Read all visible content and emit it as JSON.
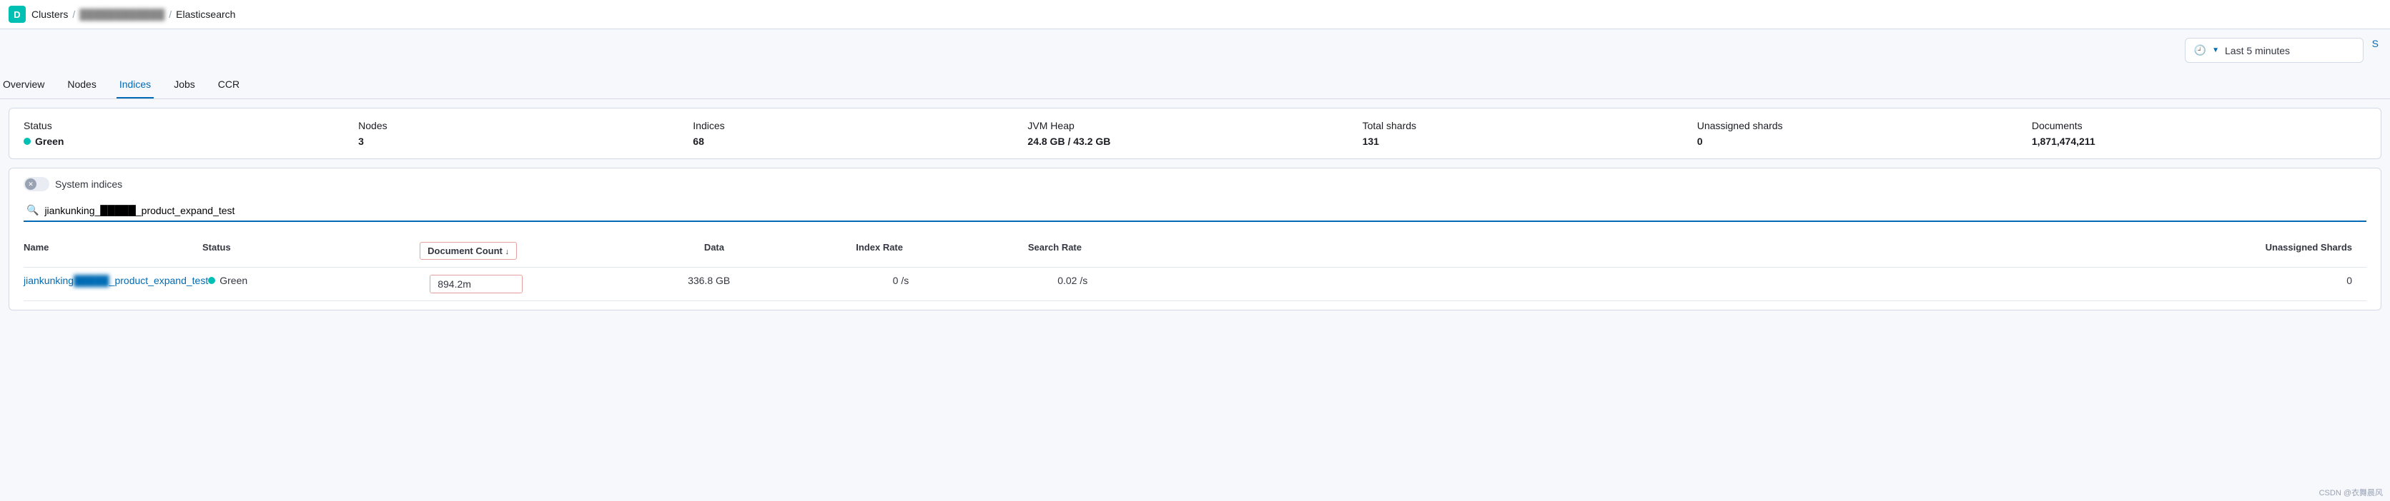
{
  "header": {
    "logo_letter": "D",
    "breadcrumb": {
      "root": "Clusters",
      "cluster_name": "████████████",
      "leaf": "Elasticsearch"
    }
  },
  "time_picker": {
    "label": "Last 5 minutes",
    "refresh_symbol": "S"
  },
  "tabs": [
    {
      "label": "Overview",
      "active": false
    },
    {
      "label": "Nodes",
      "active": false
    },
    {
      "label": "Indices",
      "active": true
    },
    {
      "label": "Jobs",
      "active": false
    },
    {
      "label": "CCR",
      "active": false
    }
  ],
  "stats": {
    "status": {
      "label": "Status",
      "value": "Green"
    },
    "nodes": {
      "label": "Nodes",
      "value": "3"
    },
    "indices": {
      "label": "Indices",
      "value": "68"
    },
    "jvm": {
      "label": "JVM Heap",
      "value": "24.8 GB / 43.2 GB"
    },
    "shards": {
      "label": "Total shards",
      "value": "131"
    },
    "unassigned": {
      "label": "Unassigned shards",
      "value": "0"
    },
    "documents": {
      "label": "Documents",
      "value": "1,871,474,211"
    }
  },
  "filter": {
    "system_indices_label": "System indices",
    "search_value": "jiankunking_█████_product_expand_test"
  },
  "table": {
    "headers": {
      "name": "Name",
      "status": "Status",
      "doc_count": "Document Count",
      "data": "Data",
      "index_rate": "Index Rate",
      "search_rate": "Search Rate",
      "unassigned": "Unassigned Shards"
    },
    "rows": [
      {
        "name_prefix": "jiankunking",
        "name_mid": "█████",
        "name_suffix": "_product_expand_test",
        "status": "Green",
        "doc_count": "894.2m",
        "data": "336.8 GB",
        "index_rate": "0 /s",
        "search_rate": "0.02 /s",
        "unassigned": "0"
      }
    ]
  },
  "footer_credit": "CSDN @衣舞晨风"
}
